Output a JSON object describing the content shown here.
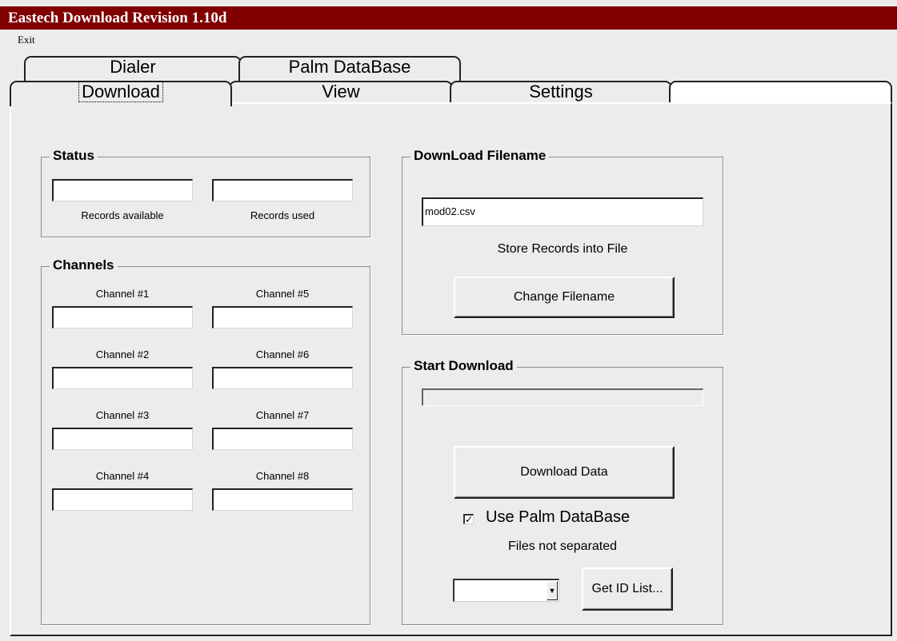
{
  "window": {
    "title": "Eastech Download Revision 1.10d"
  },
  "menu": {
    "exit": "Exit"
  },
  "tabs": {
    "back_row": [
      "Dialer",
      "Palm DataBase"
    ],
    "front_row": [
      "Download",
      "View",
      "Settings"
    ],
    "active": "Download"
  },
  "status": {
    "title": "Status",
    "records_available_label": "Records available",
    "records_available_value": "",
    "records_used_label": "Records used",
    "records_used_value": ""
  },
  "channels": {
    "title": "Channels",
    "items": [
      {
        "label": "Channel #1",
        "value": ""
      },
      {
        "label": "Channel #5",
        "value": ""
      },
      {
        "label": "Channel #2",
        "value": ""
      },
      {
        "label": "Channel #6",
        "value": ""
      },
      {
        "label": "Channel #3",
        "value": ""
      },
      {
        "label": "Channel #7",
        "value": ""
      },
      {
        "label": "Channel #4",
        "value": ""
      },
      {
        "label": "Channel #8",
        "value": ""
      }
    ]
  },
  "download_filename": {
    "title": "DownLoad Filename",
    "filename_value": "mod02.csv",
    "store_label": "Store Records into File",
    "change_button": "Change Filename"
  },
  "start_download": {
    "title": "Start Download",
    "progress": 0,
    "download_button": "Download Data",
    "use_palm_checkbox_label": "Use Palm DataBase",
    "use_palm_checked": true,
    "files_note": "Files not separated",
    "id_select_value": "",
    "get_id_button": "Get ID List..."
  },
  "colors": {
    "titlebar": "#800000",
    "face": "#ececec"
  }
}
